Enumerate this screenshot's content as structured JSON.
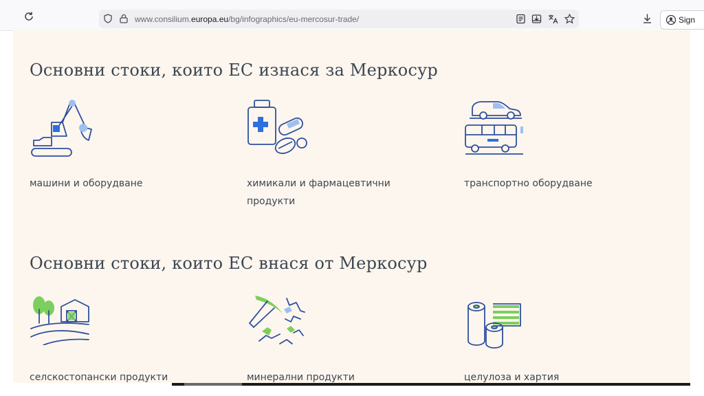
{
  "browser": {
    "url_prefix": "www.consilium.",
    "url_domain": "europa.eu",
    "url_path": "/bg/infographics/eu-mercosur-trade/",
    "sign_in_label": "Sign"
  },
  "exports": {
    "heading": "Основни стоки, които ЕС изнася за Меркосур",
    "items": [
      {
        "label": "машини и оборудване",
        "icon": "excavator-icon"
      },
      {
        "label": "химикали и фармацевтични продукти",
        "icon": "medicine-icon"
      },
      {
        "label": "транспортно оборудване",
        "icon": "vehicles-icon"
      }
    ]
  },
  "imports": {
    "heading": "Основни стоки, които ЕС внася от Меркосур",
    "items": [
      {
        "label": "селскостопански продукти",
        "icon": "farm-icon"
      },
      {
        "label": "минерални продукти",
        "icon": "pickaxe-icon"
      },
      {
        "label": "целулоза и хартия",
        "icon": "paper-rolls-icon"
      }
    ]
  },
  "colors": {
    "page_bg": "#fdf6ee",
    "line": "#2f4f9e",
    "accent_blue": "#2d6fe0",
    "light_blue": "#9ec0f0",
    "green": "#7ccf5c",
    "text": "#3c4652"
  }
}
